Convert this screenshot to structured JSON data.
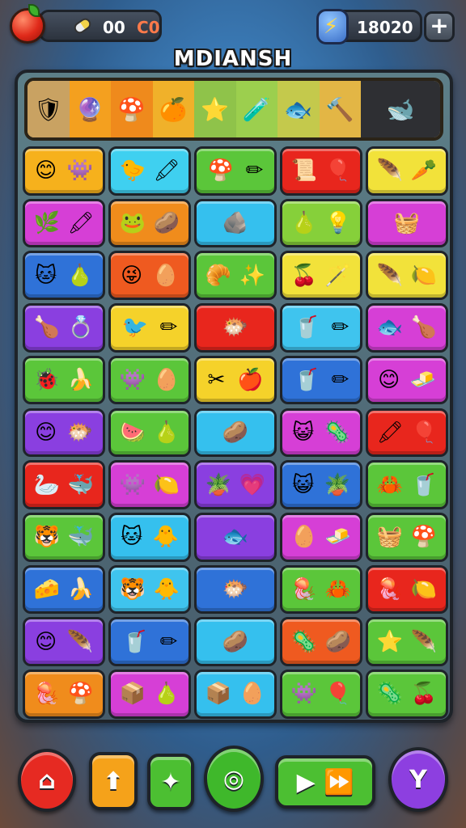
{
  "topbar": {
    "apple_icon": "apple-icon",
    "pill_icon": "pill-icon",
    "counter_value": "00",
    "counter_suffix": "C0",
    "energy_icon": "lightning-bolt-icon",
    "energy_value": "18020",
    "plus_label": "+"
  },
  "title": "MDIANSH",
  "item_bar": [
    {
      "glyph": "🛡",
      "name": "shield-item-icon",
      "bg": "#c9a262"
    },
    {
      "glyph": "🔮",
      "name": "crystal-item-icon",
      "bg": "#f4a01f"
    },
    {
      "glyph": "🍄",
      "name": "mushroom-item-icon",
      "bg": "#ef8a1c"
    },
    {
      "glyph": "🍊",
      "name": "orange-item-icon",
      "bg": "#f0b12a"
    },
    {
      "glyph": "⭐",
      "name": "star-item-icon",
      "bg": "#8fc34a"
    },
    {
      "glyph": "🧪",
      "name": "potion-item-icon",
      "bg": "#9ccf4e"
    },
    {
      "glyph": "🐟",
      "name": "fish-item-icon",
      "bg": "#c4c94c"
    },
    {
      "glyph": "🔨",
      "name": "hammer-item-icon",
      "bg": "#e3b645"
    },
    {
      "glyph": "🐋",
      "name": "whale-item-icon",
      "bg": "#2e2f33"
    }
  ],
  "tiles": [
    [
      {
        "bg": "#f6b11c",
        "g": [
          "😊",
          "👾"
        ]
      },
      {
        "bg": "#3fd0f0",
        "g": [
          "🐤",
          "🖍"
        ]
      },
      {
        "bg": "#5bc63a",
        "g": [
          "🍄",
          "✏"
        ]
      },
      {
        "bg": "#e8261d",
        "g": [
          "📜",
          "🎈"
        ]
      },
      {
        "bg": "#f2e23a",
        "g": [
          "🪶",
          "🥕"
        ]
      }
    ],
    [
      {
        "bg": "#d63fd6",
        "g": [
          "🌿",
          "🖍"
        ]
      },
      {
        "bg": "#f08c1c",
        "g": [
          "🐸",
          "🥔"
        ]
      },
      {
        "bg": "#35c0ee",
        "g": [
          "🪨"
        ]
      },
      {
        "bg": "#86d03a",
        "g": [
          "🍐",
          "💡"
        ]
      },
      {
        "bg": "#d63fd6",
        "g": [
          "🧺"
        ]
      }
    ],
    [
      {
        "bg": "#2f72d8",
        "g": [
          "🐱",
          "🍐"
        ]
      },
      {
        "bg": "#ef5a20",
        "g": [
          "😜",
          "🥚"
        ]
      },
      {
        "bg": "#5bc63a",
        "g": [
          "🥐",
          "✨"
        ]
      },
      {
        "bg": "#f2e23a",
        "g": [
          "🍒",
          "🪄"
        ]
      },
      {
        "bg": "#f2e23a",
        "g": [
          "🪶",
          "🍋"
        ]
      }
    ],
    [
      {
        "bg": "#8a3fe0",
        "g": [
          "🍗",
          "💍"
        ]
      },
      {
        "bg": "#f5d22a",
        "g": [
          "🐦",
          "✏"
        ]
      },
      {
        "bg": "#e8261d",
        "g": [
          "🐡"
        ]
      },
      {
        "bg": "#3fc4ee",
        "g": [
          "🥤",
          "✏"
        ]
      },
      {
        "bg": "#d63fd6",
        "g": [
          "🐟",
          "🍗"
        ]
      }
    ],
    [
      {
        "bg": "#5bc63a",
        "g": [
          "🐞",
          "🍌"
        ]
      },
      {
        "bg": "#5bc63a",
        "g": [
          "👾",
          "🥚"
        ]
      },
      {
        "bg": "#f5d22a",
        "g": [
          "✂",
          "🍎"
        ]
      },
      {
        "bg": "#2f72d8",
        "g": [
          "🥤",
          "✏"
        ]
      },
      {
        "bg": "#d63fd6",
        "g": [
          "😊",
          "🧈"
        ]
      }
    ],
    [
      {
        "bg": "#8a3fe0",
        "g": [
          "😊",
          "🐡"
        ]
      },
      {
        "bg": "#5bc63a",
        "g": [
          "🍉",
          "🍐"
        ]
      },
      {
        "bg": "#35c0ee",
        "g": [
          "🥔"
        ]
      },
      {
        "bg": "#d63fd6",
        "g": [
          "😺",
          "🦠"
        ]
      },
      {
        "bg": "#e8261d",
        "g": [
          "🖍",
          "🎈"
        ]
      }
    ],
    [
      {
        "bg": "#e8261d",
        "g": [
          "🦢",
          "🐳"
        ]
      },
      {
        "bg": "#d63fd6",
        "g": [
          "👾",
          "🍋"
        ]
      },
      {
        "bg": "#8a3fe0",
        "g": [
          "🪴",
          "💗"
        ]
      },
      {
        "bg": "#2f72d8",
        "g": [
          "😺",
          "🪴"
        ]
      },
      {
        "bg": "#5bc63a",
        "g": [
          "🦀",
          "🥤"
        ]
      }
    ],
    [
      {
        "bg": "#5bc63a",
        "g": [
          "🐯",
          "🐳"
        ]
      },
      {
        "bg": "#35c0ee",
        "g": [
          "🐱",
          "🐥"
        ]
      },
      {
        "bg": "#8a3fe0",
        "g": [
          "🐟"
        ]
      },
      {
        "bg": "#d63fd6",
        "g": [
          "🥚",
          "🧈"
        ]
      },
      {
        "bg": "#5bc63a",
        "g": [
          "🧺",
          "🍄"
        ]
      }
    ],
    [
      {
        "bg": "#2f72d8",
        "g": [
          "🧀",
          "🍌"
        ]
      },
      {
        "bg": "#3fc4ee",
        "g": [
          "🐯",
          "🐥"
        ]
      },
      {
        "bg": "#2f72d8",
        "g": [
          "🐡"
        ]
      },
      {
        "bg": "#5bc63a",
        "g": [
          "🪼",
          "🦀"
        ]
      },
      {
        "bg": "#e8261d",
        "g": [
          "🪼",
          "🍋"
        ]
      }
    ],
    [
      {
        "bg": "#8a3fe0",
        "g": [
          "😊",
          "🪶"
        ]
      },
      {
        "bg": "#2f72d8",
        "g": [
          "🥤",
          "✏"
        ]
      },
      {
        "bg": "#35c0ee",
        "g": [
          "🥔"
        ]
      },
      {
        "bg": "#ef5a20",
        "g": [
          "🦠",
          "🥔"
        ]
      },
      {
        "bg": "#5bc63a",
        "g": [
          "⭐",
          "🪶"
        ]
      }
    ],
    [
      {
        "bg": "#f08c1c",
        "g": [
          "🪼",
          "🍄"
        ]
      },
      {
        "bg": "#d63fd6",
        "g": [
          "📦",
          "🍐"
        ]
      },
      {
        "bg": "#35c0ee",
        "g": [
          "📦",
          "🥚"
        ]
      },
      {
        "bg": "#5bc63a",
        "g": [
          "👾",
          "🎈"
        ]
      },
      {
        "bg": "#5bc63a",
        "g": [
          "🦠",
          "🍒"
        ]
      }
    ]
  ],
  "nav": [
    {
      "name": "home-button",
      "icon": "⌂",
      "icon_name": "home-icon",
      "color": "#e62a22",
      "round": true
    },
    {
      "name": "tree-button",
      "icon": "⬆",
      "icon_name": "tree-icon",
      "color": "#f5a21a",
      "round": false
    },
    {
      "name": "character-button",
      "icon": "✦",
      "icon_name": "character-icon",
      "color": "#4cbf32",
      "round": false
    },
    {
      "name": "target-button",
      "icon": "◎",
      "icon_name": "target-icon",
      "color": "#3fb82b",
      "round": true
    },
    {
      "name": "play-button",
      "icon": "▶ ⏩",
      "icon_name": "play-icon",
      "color": "#4cbf32",
      "round": false
    },
    {
      "name": "profile-button",
      "icon": "Y",
      "icon_name": "profile-icon",
      "color": "#8d3fe0",
      "round": true
    }
  ]
}
